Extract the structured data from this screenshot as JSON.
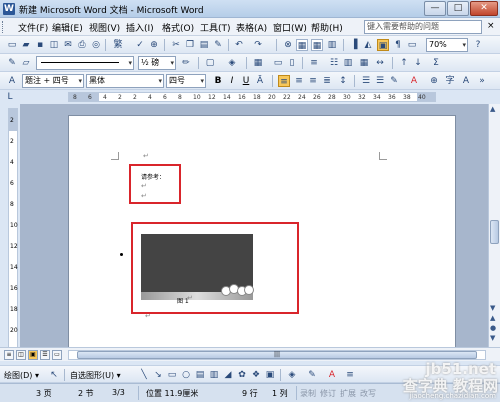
{
  "window": {
    "title": "新建 Microsoft Word 文档 - Microsoft Word",
    "icon": "W",
    "min_label": "—",
    "max_label": "□",
    "close_label": "✕"
  },
  "menu": {
    "items": [
      "文件(F)",
      "编辑(E)",
      "视图(V)",
      "插入(I)",
      "格式(O)",
      "工具(T)",
      "表格(A)",
      "窗口(W)",
      "帮助(H)"
    ],
    "help_placeholder": "键入需要帮助的问题",
    "close_doc": "×"
  },
  "toolbar_standard": {
    "font_symbol_label": "繁",
    "zoom": "70%"
  },
  "toolbar_draw_table": {
    "line_weight": "½ 磅"
  },
  "toolbar_format": {
    "style": "题注 + 四号",
    "font": "黑体",
    "size": "四号",
    "bold": "B",
    "italic": "I",
    "underline": "U"
  },
  "ruler": {
    "h_ticks": [
      "8",
      "6",
      "4",
      "2",
      "2",
      "4",
      "6",
      "8",
      "10",
      "12",
      "14",
      "16",
      "18",
      "20",
      "22",
      "24",
      "26",
      "28",
      "30",
      "32",
      "34",
      "36",
      "38",
      "40"
    ],
    "v_ticks": [
      "2",
      "2",
      "4",
      "6",
      "8",
      "10",
      "12",
      "14",
      "16",
      "18",
      "20"
    ]
  },
  "document": {
    "heading_text": "请参考：",
    "caption": "图 1",
    "para_mark": "↵"
  },
  "drawing_toolbar": {
    "draw_label": "绘图(D) ▾",
    "autoshapes_label": "自选图形(U) ▾"
  },
  "status": {
    "page": "3 页",
    "section": "2 节",
    "page_of": "3/3",
    "position": "位置 11.9厘米",
    "line": "9 行",
    "column": "1 列",
    "rec": "录制",
    "trk": "修订",
    "ext": "扩展",
    "ovr": "改写"
  },
  "watermark": {
    "line1": "jb51.net",
    "line2": "查字典 教程网",
    "line3": "jiaocheng.chazidian.com"
  },
  "colors": {
    "highlight_red": "#d9252b",
    "active_button": "#f7c75a",
    "toolbar_blue": "#dde7f3"
  }
}
